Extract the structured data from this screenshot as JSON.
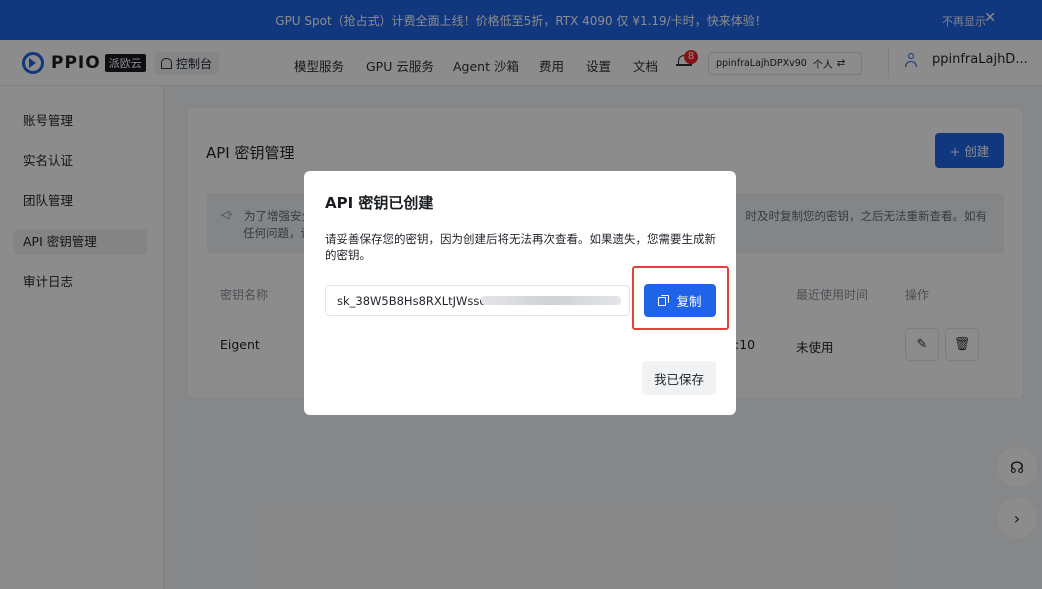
{
  "banner": {
    "text": "GPU Spot（抢占式）计费全面上线！价格低至5折，RTX 4090 仅 ¥1.19/卡时，快来体验！",
    "hide_label": "不再显示",
    "close_glyph": "✕"
  },
  "nav": {
    "logo_text": "PPIO",
    "logo_sub": "派欧云",
    "console_label": "控制台",
    "menu": [
      "模型服务",
      "GPU 云服务",
      "Agent 沙箱",
      "费用",
      "设置",
      "文档"
    ],
    "notification_count": "8",
    "account_selector": "ppinfraLajhDPXv90",
    "account_type": "个人",
    "switch_glyph": "⇄",
    "username": "ppinfraLajhD..."
  },
  "sidebar": {
    "items": [
      {
        "label": "账号管理"
      },
      {
        "label": "实名认证"
      },
      {
        "label": "团队管理"
      },
      {
        "label": "API 密钥管理"
      },
      {
        "label": "审计日志"
      }
    ],
    "active_index": 3
  },
  "main": {
    "title": "API 密钥管理",
    "create_label": "+ 创建",
    "notice_line1": "为了增强安全",
    "notice_line2": "任何问题，请",
    "notice_tail": "时及时复制您的密钥，之后无法重新查看。如有",
    "table": {
      "headers": [
        "密钥名称",
        "最近使用时间",
        "操作"
      ],
      "row": {
        "name": "Eigent",
        "time_fragment": ":10",
        "last_used": "未使用"
      }
    }
  },
  "dialog": {
    "title": "API 密钥已创建",
    "description": "请妥善保存您的密钥，因为创建后将无法再次查看。如果遗失，您需要生成新的密钥。",
    "key_value": "sk_38W5B8Hs8RXLtJWssc",
    "copy_label": "复制",
    "saved_label": "我已保存"
  },
  "colors": {
    "primary": "#1f64e8",
    "highlight": "#e5403a",
    "badge": "#f5222d"
  }
}
